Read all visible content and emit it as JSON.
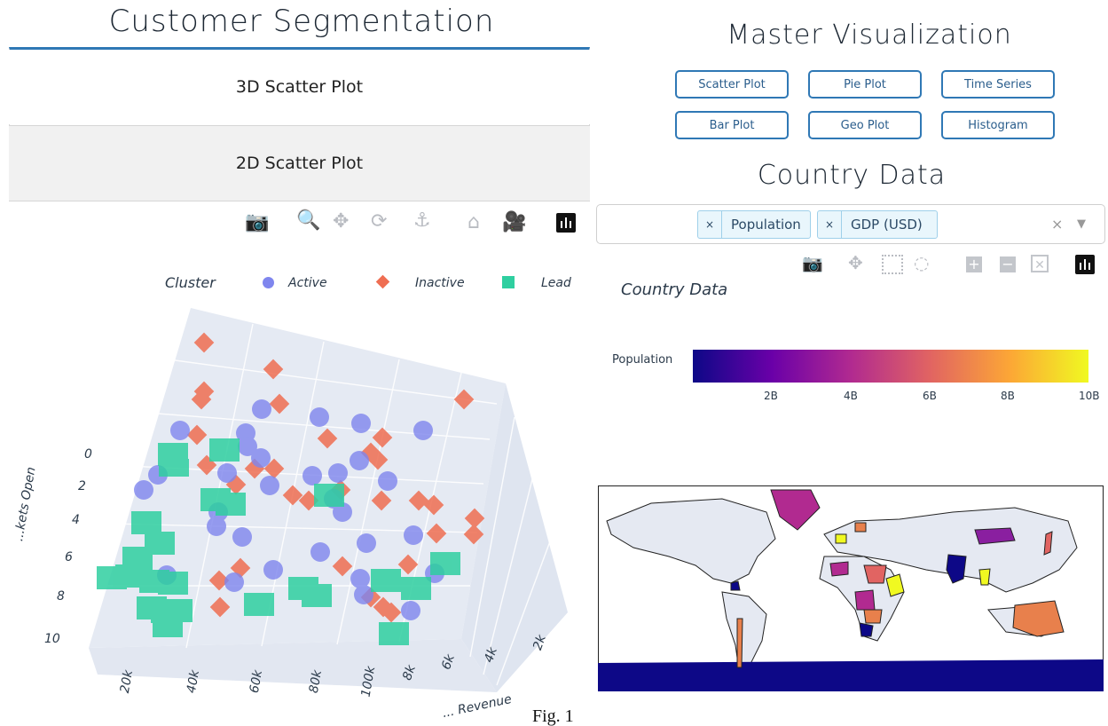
{
  "left": {
    "title": "Customer Segmentation",
    "buttons": [
      "3D Scatter Plot",
      "2D Scatter Plot"
    ]
  },
  "right": {
    "title": "Master Visualization",
    "viz_buttons": [
      "Scatter Plot",
      "Pie Plot",
      "Time Series",
      "Bar Plot",
      "Geo Plot",
      "Histogram"
    ],
    "country_title": "Country Data",
    "dropdown": {
      "chips": [
        "Population",
        "GDP (USD)"
      ],
      "chip_remove": "×",
      "clear_icon": "×",
      "arrow_icon": "▼"
    },
    "map_title": "Country Data",
    "colorbar": {
      "label": "Population",
      "ticks": [
        "2B",
        "4B",
        "6B",
        "8B",
        "10B"
      ],
      "colors": [
        "#0d0887",
        "#6a00a8",
        "#b12a90",
        "#e16462",
        "#fca636",
        "#f0f921"
      ]
    }
  },
  "scatter3d": {
    "legend_title": "Cluster",
    "legend": [
      {
        "name": "Active",
        "color": "#7f86ee"
      },
      {
        "name": "Inactive",
        "color": "#ef6e52"
      },
      {
        "name": "Lead",
        "color": "#2fcfa0"
      }
    ],
    "y_ticks": [
      "0",
      "2",
      "4",
      "6",
      "8",
      "10"
    ],
    "y_label": "...kets Open",
    "x_ticks": [
      "20k",
      "40k",
      "60k",
      "80k",
      "100k"
    ],
    "z_ticks": [
      "8k",
      "6k",
      "4k",
      "2k"
    ],
    "z_label": "... Revenue"
  },
  "caption": "Fig. 1"
}
